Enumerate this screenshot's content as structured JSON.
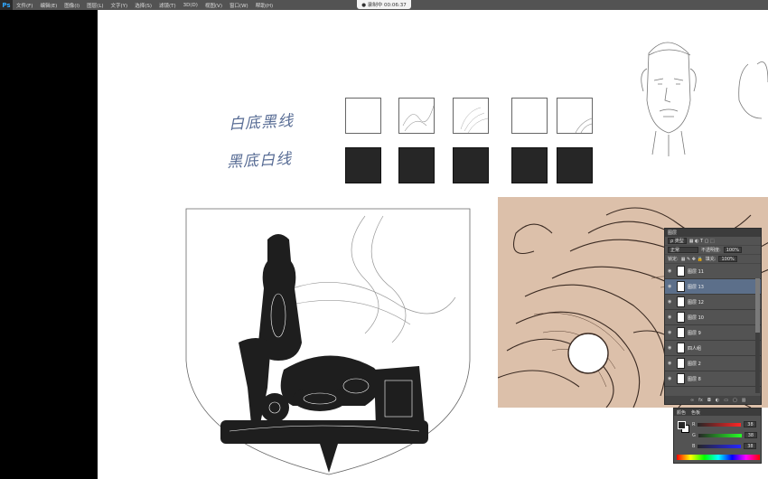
{
  "menubar": {
    "app_logo": "Ps",
    "items": [
      "文件(F)",
      "编辑(E)",
      "图像(I)",
      "图层(L)",
      "文字(Y)",
      "选择(S)",
      "滤镜(T)",
      "3D(D)",
      "视图(V)",
      "窗口(W)",
      "帮助(H)"
    ],
    "recording_label": "● 录制中 00:06:37"
  },
  "canvas": {
    "labels": {
      "row1": "白底黑线",
      "row2": "黑底白线"
    }
  },
  "layers_panel": {
    "title": "图层",
    "filter_label": "ρ 类型",
    "blend_mode": "正常",
    "opacity_label": "不透明度:",
    "opacity_value": "100%",
    "lock_label": "锁定:",
    "fill_label": "填充:",
    "fill_value": "100%",
    "layers": [
      {
        "name": "图层 11",
        "selected": false
      },
      {
        "name": "图层 13",
        "selected": true
      },
      {
        "name": "图层 12",
        "selected": false
      },
      {
        "name": "图层 10",
        "selected": false
      },
      {
        "name": "图层 9",
        "selected": false
      },
      {
        "name": "四人组",
        "selected": false
      },
      {
        "name": "图层 2",
        "selected": false
      },
      {
        "name": "图层 8",
        "selected": false
      }
    ]
  },
  "color_panel": {
    "tabs": [
      "颜色",
      "色板"
    ],
    "channels": [
      {
        "label": "R",
        "value": "38"
      },
      {
        "label": "G",
        "value": "38"
      },
      {
        "label": "B",
        "value": "38"
      }
    ],
    "colors": {
      "foreground": "#262626",
      "background": "#ffffff",
      "selected_layer": "#5c6f8a"
    }
  }
}
